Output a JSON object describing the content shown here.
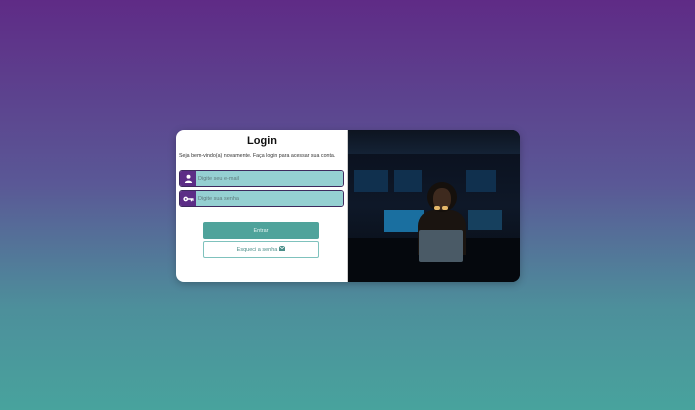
{
  "login": {
    "title": "Login",
    "subtitle": "Seja bem-vindo(a) novamente. Faça login para acessar sua conta.",
    "email_placeholder": "Digite seu e-mail",
    "password_placeholder": "Digite sua senha",
    "submit_label": "Entrar",
    "forgot_label": "Esqueci a senha"
  },
  "icons": {
    "email": "user-icon",
    "password": "key-icon",
    "forgot": "envelope-icon"
  },
  "colors": {
    "primary": "#5c2d86",
    "accent": "#4fa39b",
    "field_bg": "#95d0d2"
  }
}
